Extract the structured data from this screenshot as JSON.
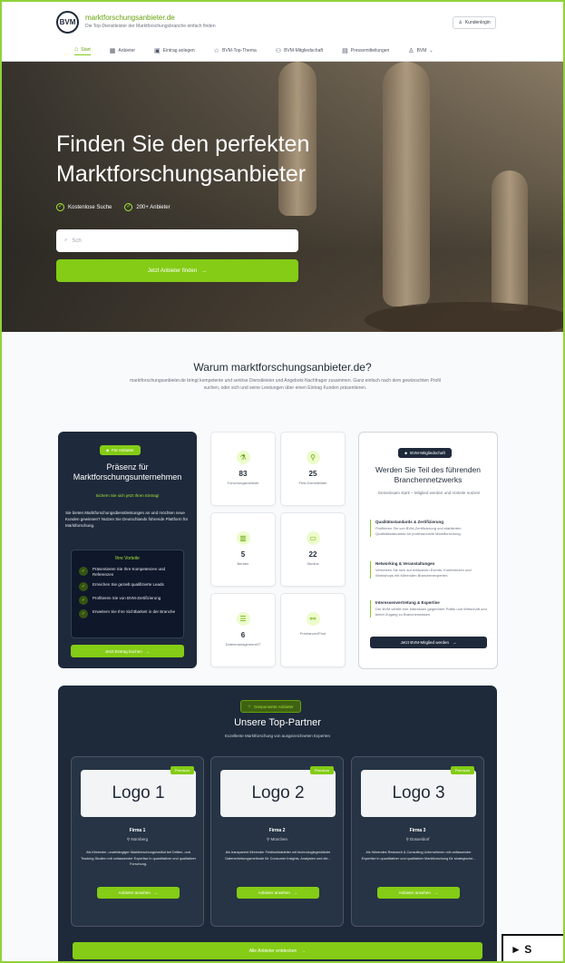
{
  "header": {
    "logo_text": "BVM",
    "brand": "marktforschungsanbieter.de",
    "tagline": "Die Top-Dienstleister der Marktforschungsbranche einfach finden",
    "login_label": "Kundenlogin",
    "nav": [
      {
        "label": "Start",
        "icon": "home-icon",
        "glyph": "⌂"
      },
      {
        "label": "Anbieter",
        "icon": "building-icon",
        "glyph": "▦"
      },
      {
        "label": "Eintrag anlegen",
        "icon": "register-icon",
        "glyph": "▣"
      },
      {
        "label": "BVM-Top-Thema",
        "icon": "star-icon",
        "glyph": "☆"
      },
      {
        "label": "BVM-Mitgliedschaft",
        "icon": "members-icon",
        "glyph": "⚇"
      },
      {
        "label": "Pressemitteilungen",
        "icon": "news-icon",
        "glyph": "▤"
      },
      {
        "label": "BVM",
        "icon": "user-icon",
        "glyph": "♙"
      }
    ]
  },
  "hero": {
    "title": "Finden Sie den perfekten Marktforschungsanbieter",
    "badges": [
      "Kostenlose Suche",
      "200+ Anbieter"
    ],
    "search_value": "Sch",
    "cta_label": "Jetzt Anbieter finden"
  },
  "why": {
    "title": "Warum marktforschungsanbieter.de?",
    "text": "marktforschungsanbieter.de bringt kompetente und seriöse Dienstleister und Angebots-Nachfrager zusammen. Ganz einfach nach dem gewünschten Profil suchen, oder sich und seine Leistungen über einen Eintrag Kunden präsentieren."
  },
  "provider": {
    "pill": "Für Anbieter",
    "title": "Präsenz für Marktforschungsunternehmen",
    "subtitle": "Sichern Sie sich jetzt Ihren Eintrag!",
    "text": "Sie bieten Marktforschungsdienstleistungen an und möchten neue Kunden gewinnen? Nutzen Sie Deutschlands führende Plattform für Marktforschung.",
    "advantages_title": "Ihre Vorteile",
    "advantages": [
      "Präsentieren Sie Ihre Kompetenzen und Referenzen",
      "Erreichen Sie gezielt qualifizierte Leads",
      "Profitieren Sie von BVM-Zertifizierung",
      "Erweitern Sie Ihre Sichtbarkeit in der Branche"
    ],
    "cta_label": "Jetzt Eintrag buchen"
  },
  "stats": [
    {
      "value": "83",
      "label": "Forschungsinstitute",
      "icon": "institute-icon",
      "glyph": "⚗"
    },
    {
      "value": "25",
      "label": "Feld-Dienstleister",
      "icon": "fieldwork-icon",
      "glyph": "⚲"
    },
    {
      "value": "5",
      "label": "Berater",
      "icon": "consultant-icon",
      "glyph": "▥"
    },
    {
      "value": "22",
      "label": "Studios",
      "icon": "studio-icon",
      "glyph": "▭"
    },
    {
      "value": "6",
      "label": "Datenmanagement/IT",
      "icon": "database-icon",
      "glyph": "☰"
    },
    {
      "value": "",
      "label": "Freelancer/Pool",
      "icon": "freelancer-icon",
      "glyph": "⚯"
    }
  ],
  "membership": {
    "pill": "BVM-Mitgliedschaft",
    "title": "Werden Sie Teil des führenden Branchennetzwerks",
    "subtitle": "Gemeinsam stark – Mitglied werden und Vorteile nutzen!",
    "sections": [
      {
        "heading": "Qualitätsstandards & Zertifizierung",
        "text": "Profitieren Sie von BVM-Zertifizierung und etablierten Qualitätsstandards für professionelle Marktforschung."
      },
      {
        "heading": "Networking & Veranstaltungen",
        "text": "Vernetzen Sie sich auf exklusiven Events, Konferenzen und Workshops mit führenden Branchenexperten."
      },
      {
        "heading": "Interessenvertretung & Expertise",
        "text": "Der BVM vertritt Ihre Interessen gegenüber Politik und Wirtschaft und bietet Zugang zu Branchenwissen."
      }
    ],
    "cta_label": "Jetzt BVM-Mitglied werden"
  },
  "partners": {
    "pill": "Gesponserte Anbieter",
    "title": "Unsere Top-Partner",
    "subtitle": "Exzellente Marktforschung von ausgezeichneten Experten",
    "badge": "Premium",
    "button_label": "Anbieter ansehen",
    "items": [
      {
        "logo": "Logo 1",
        "name": "Firma 1",
        "city": "Nürnberg",
        "description": "Als führender, unabhängiger Marktforschungsinstitut bei Dritten- und Tracking-Studien mit umfassender Expertise in quantitativer und qualitativer Forschung."
      },
      {
        "logo": "Logo 2",
        "name": "Firma 2",
        "city": "München",
        "description": "Als transparent führender Feldinstitutsleiter mit technologiegestützter Datenerhebungsmethode für Consumer Insights, Analysten und die..."
      },
      {
        "logo": "Logo 3",
        "name": "Firma 3",
        "city": "Düsseldorf",
        "description": "Als führendes Research & Consulting Unternehmen mit umfassender Expertise in quantitativer und qualitativer Marktforschung für strategische..."
      }
    ],
    "all_label": "Alle Anbieter entdecken"
  },
  "corner_label": "► S"
}
